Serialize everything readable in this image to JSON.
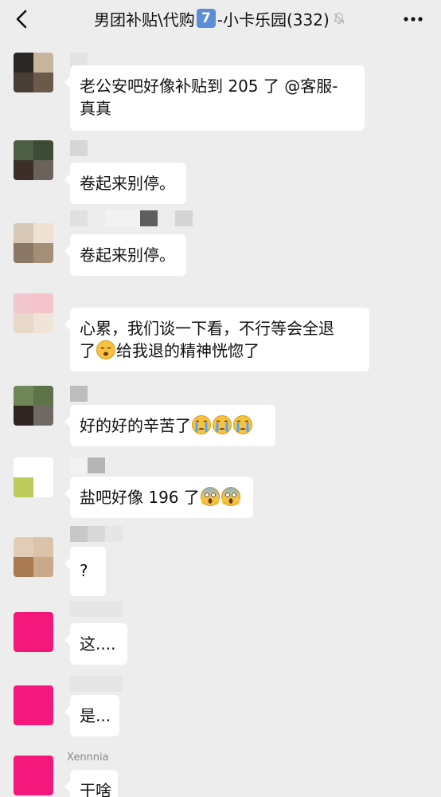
{
  "header": {
    "back_icon": "chevron-left-icon",
    "title_prefix": "男团补贴\\代购",
    "badge": "7",
    "title_suffix": "-小卡乐园(332)",
    "mute_icon": "bell-mute-icon",
    "more_icon": "more-dots-icon"
  },
  "messages": [
    {
      "sender": "",
      "line1": "老公安吧好像补贴到 205 了 @客服-",
      "line2": "真真"
    },
    {
      "sender": "",
      "text": "卷起来别停。"
    },
    {
      "sender": "",
      "text": "卷起来别停。"
    },
    {
      "sender": "",
      "line1": "心累，我们谈一下看，不行等会全退",
      "line2_prefix": "了",
      "line2_suffix": "给我退的精神恍惚了"
    },
    {
      "sender": "",
      "text": "好的好的辛苦了"
    },
    {
      "sender": "",
      "text": "盐吧好像 196 了"
    },
    {
      "sender": "",
      "text": "?"
    },
    {
      "sender": "",
      "text": "这...."
    },
    {
      "sender": "",
      "text": "是..."
    },
    {
      "sender": "Xennnia",
      "text": "干啥"
    }
  ],
  "colors": {
    "background": "#ededed",
    "bubble": "#ffffff",
    "badge": "#5b8ed6",
    "magenta_avatar": "#f5187c"
  }
}
